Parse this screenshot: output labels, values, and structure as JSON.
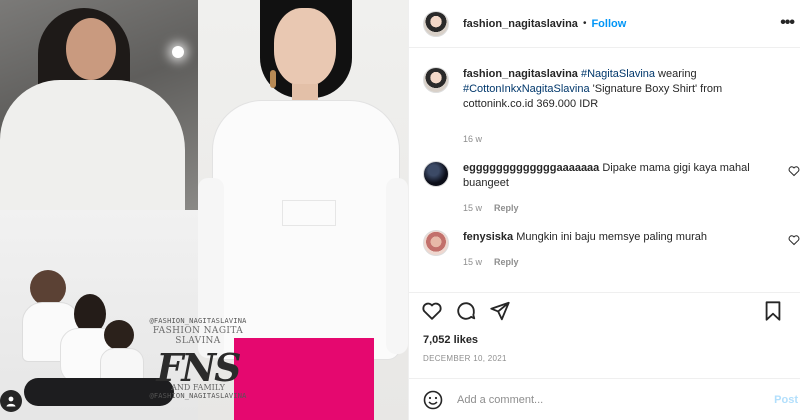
{
  "post": {
    "author": "fashion_nagitaslavina",
    "follow_label": "Follow",
    "separator": "•",
    "more_label": "•••",
    "caption": {
      "username": "fashion_nagitaslavina",
      "tag1": "#NagitaSlavina",
      "text1": " wearing ",
      "tag2": "#CottonInkxNagitaSlavina",
      "text2": " 'Signature Boxy Shirt' from cottonink.co.id 369.000 IDR",
      "time": "16 w"
    },
    "comments": [
      {
        "username": "egggggggggggggaaaaaaa",
        "text": "Dipake mama gigi kaya mahal buangeet",
        "time": "15 w",
        "reply_label": "Reply"
      },
      {
        "username": "fenysiska",
        "text": "Mungkin ini baju memsye paling murah",
        "time": "15 w",
        "reply_label": "Reply"
      }
    ],
    "likes": "7,052 likes",
    "date": "DECEMBER 10, 2021",
    "comment_placeholder": "Add a comment...",
    "post_label": "Post"
  },
  "overlay": {
    "handle_top": "@FASHION_NAGITASLAVINA",
    "name": "FASHION NAGITA SLAVINA",
    "big": "FNS",
    "sub": "AND FAMILY",
    "handle_bottom": "@FASHION_NAGITASLAVINA"
  },
  "icons": {
    "like": "heart-icon",
    "comment": "comment-icon",
    "share": "share-icon",
    "save": "bookmark-icon",
    "emoji": "emoji-icon",
    "tag": "user-tag-icon"
  },
  "colors": {
    "accent": "#0095f6",
    "skirt": "#e5086f"
  }
}
